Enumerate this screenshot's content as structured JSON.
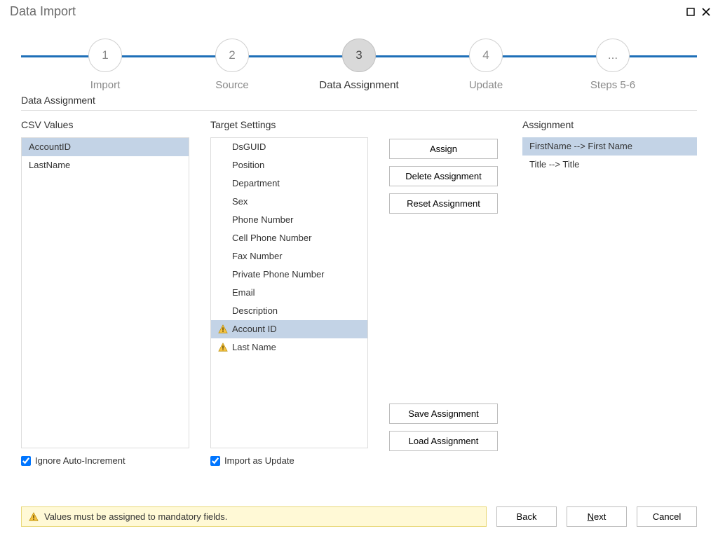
{
  "window": {
    "title": "Data Import"
  },
  "stepper": {
    "activeIndex": 2,
    "steps": [
      {
        "num": "1",
        "label": "Import"
      },
      {
        "num": "2",
        "label": "Source"
      },
      {
        "num": "3",
        "label": "Data Assignment"
      },
      {
        "num": "4",
        "label": "Update"
      },
      {
        "num": "...",
        "label": "Steps 5-6"
      }
    ]
  },
  "section": {
    "title": "Data Assignment"
  },
  "csv": {
    "header": "CSV Values",
    "items": [
      "AccountID",
      "LastName"
    ],
    "selectedIndex": 0,
    "checkbox": "Ignore Auto-Increment",
    "checked": true
  },
  "target": {
    "header": "Target Settings",
    "items": [
      {
        "label": "DsGUID",
        "warn": false
      },
      {
        "label": "Position",
        "warn": false
      },
      {
        "label": "Department",
        "warn": false
      },
      {
        "label": "Sex",
        "warn": false
      },
      {
        "label": "Phone Number",
        "warn": false
      },
      {
        "label": "Cell Phone Number",
        "warn": false
      },
      {
        "label": "Fax Number",
        "warn": false
      },
      {
        "label": "Private Phone Number",
        "warn": false
      },
      {
        "label": "Email",
        "warn": false
      },
      {
        "label": "Description",
        "warn": false
      },
      {
        "label": "Account ID",
        "warn": true
      },
      {
        "label": "Last Name",
        "warn": true
      }
    ],
    "selectedIndex": 10,
    "checkbox": "Import as Update",
    "checked": true
  },
  "actions": {
    "assign": "Assign",
    "delete": "Delete Assignment",
    "reset": "Reset Assignment",
    "save": "Save Assignment",
    "load": "Load Assignment"
  },
  "assignment": {
    "header": "Assignment",
    "items": [
      "FirstName --> First Name",
      "Title --> Title"
    ],
    "selectedIndex": 0
  },
  "footer": {
    "warning": "Values must be assigned to mandatory fields.",
    "back": "Back",
    "next_pre": "",
    "next_mnemonic": "N",
    "next_post": "ext",
    "cancel": "Cancel"
  }
}
